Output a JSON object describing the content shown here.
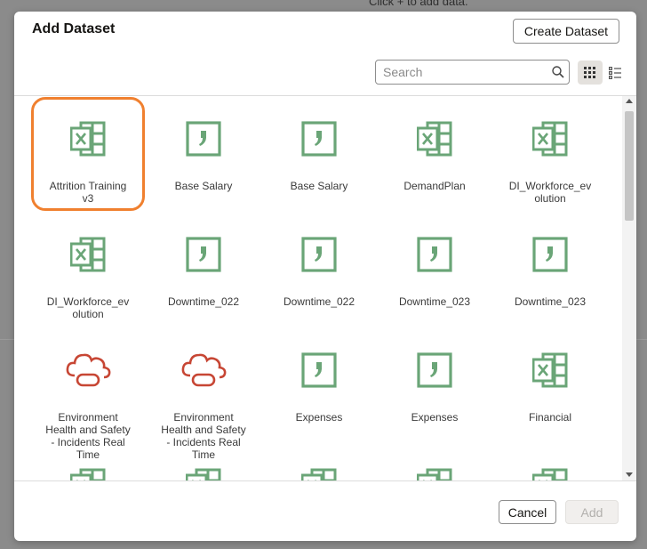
{
  "background": {
    "hint_text": "Click  +  to add data."
  },
  "dialog": {
    "title": "Add Dataset",
    "create_button": "Create Dataset",
    "search": {
      "placeholder": "Search",
      "value": ""
    },
    "view_modes": {
      "grid_icon": "grid-view-icon",
      "list_icon": "list-view-icon",
      "active": "grid"
    },
    "datasets": [
      {
        "label": "Attrition Training v3",
        "lines": [
          "Attrition Training",
          "v3"
        ],
        "icon": "excel",
        "selected": true
      },
      {
        "label": "Base Salary",
        "lines": [
          "Base Salary"
        ],
        "icon": "subject-area"
      },
      {
        "label": "Base Salary",
        "lines": [
          "Base Salary"
        ],
        "icon": "subject-area"
      },
      {
        "label": "DemandPlan",
        "lines": [
          "DemandPlan"
        ],
        "icon": "excel"
      },
      {
        "label": "DI_Workforce_evolution",
        "lines": [
          "DI_Workforce_ev",
          "olution"
        ],
        "icon": "excel"
      },
      {
        "label": "DI_Workforce_evolution",
        "lines": [
          "DI_Workforce_ev",
          "olution"
        ],
        "icon": "excel"
      },
      {
        "label": "Downtime_022",
        "lines": [
          "Downtime_022"
        ],
        "icon": "subject-area"
      },
      {
        "label": "Downtime_022",
        "lines": [
          "Downtime_022"
        ],
        "icon": "subject-area"
      },
      {
        "label": "Downtime_023",
        "lines": [
          "Downtime_023"
        ],
        "icon": "subject-area"
      },
      {
        "label": "Downtime_023",
        "lines": [
          "Downtime_023"
        ],
        "icon": "subject-area"
      },
      {
        "label": "Environment Health and Safety - Incidents Real Time",
        "lines": [
          "Environment",
          "Health and Safety",
          "- Incidents Real",
          "Time"
        ],
        "icon": "cloud"
      },
      {
        "label": "Environment Health and Safety - Incidents Real Time",
        "lines": [
          "Environment",
          "Health and Safety",
          "- Incidents Real",
          "Time"
        ],
        "icon": "cloud"
      },
      {
        "label": "Expenses",
        "lines": [
          "Expenses"
        ],
        "icon": "subject-area"
      },
      {
        "label": "Expenses",
        "lines": [
          "Expenses"
        ],
        "icon": "subject-area"
      },
      {
        "label": "Financial",
        "lines": [
          "Financial"
        ],
        "icon": "excel"
      },
      {
        "icon": "excel",
        "lines": []
      },
      {
        "icon": "excel",
        "lines": []
      },
      {
        "icon": "excel",
        "lines": []
      },
      {
        "icon": "excel",
        "lines": []
      },
      {
        "icon": "excel",
        "lines": []
      }
    ],
    "cancel_button": "Cancel",
    "add_button": "Add",
    "add_enabled": false
  },
  "colors": {
    "icon_green": "#6aa577",
    "icon_red": "#c74634",
    "selection": "#f0802f",
    "overlay": "#8b8b8b"
  }
}
